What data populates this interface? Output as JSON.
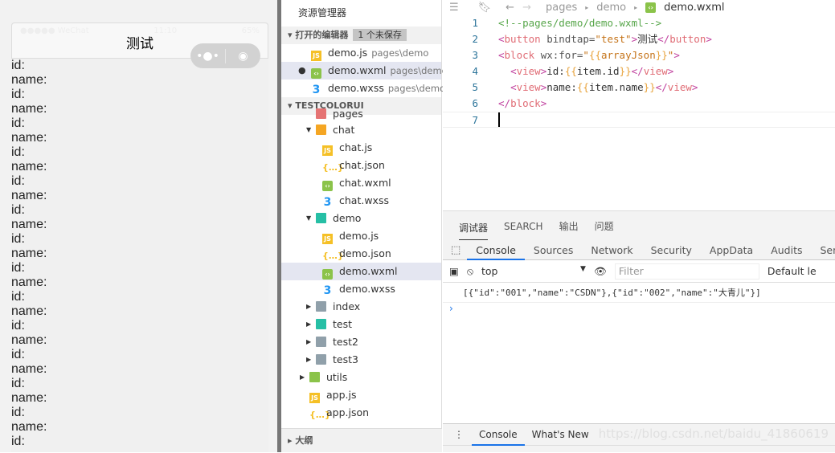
{
  "simulator": {
    "status_left": "●●●●● WeChat",
    "time": "11:10",
    "battery": "65%",
    "nav_title": "测试",
    "capsule_more": "•●•",
    "capsule_close": "◉",
    "content_lines": [
      "id:",
      "name:",
      "id:",
      "name:",
      "id:",
      "name:",
      "id:",
      "name:",
      "id:",
      "name:",
      "id:",
      "name:",
      "id:",
      "name:",
      "id:",
      "name:",
      "id:",
      "name:",
      "id:",
      "name:",
      "id:",
      "name:",
      "id:",
      "name:",
      "id:",
      "name:",
      "id:"
    ]
  },
  "explorer": {
    "title": "资源管理器",
    "open_editors": "打开的编辑器",
    "unsaved": "1 个未保存",
    "open_files": [
      {
        "name": "demo.js",
        "path": "pages\\demo",
        "type": "js"
      },
      {
        "name": "demo.wxml",
        "path": "pages\\demo",
        "type": "wx",
        "modified": true,
        "selected": true
      },
      {
        "name": "demo.wxss",
        "path": "pages\\demo",
        "type": "css"
      }
    ],
    "project": "TESTCOLORUI",
    "tree": [
      {
        "name": "pages",
        "type": "folder-red",
        "indent": 1,
        "partial": true
      },
      {
        "name": "chat",
        "type": "folder-orange",
        "indent": 1,
        "arrow": "▼"
      },
      {
        "name": "chat.js",
        "type": "js",
        "indent": 2
      },
      {
        "name": "chat.json",
        "type": "json",
        "indent": 2
      },
      {
        "name": "chat.wxml",
        "type": "wx",
        "indent": 2
      },
      {
        "name": "chat.wxss",
        "type": "css",
        "indent": 2
      },
      {
        "name": "demo",
        "type": "folder-teal",
        "indent": 1,
        "arrow": "▼"
      },
      {
        "name": "demo.js",
        "type": "js",
        "indent": 2
      },
      {
        "name": "demo.json",
        "type": "json",
        "indent": 2
      },
      {
        "name": "demo.wxml",
        "type": "wx",
        "indent": 2,
        "selected": true
      },
      {
        "name": "demo.wxss",
        "type": "css",
        "indent": 2
      },
      {
        "name": "index",
        "type": "folder",
        "indent": 1,
        "arrow": "▶"
      },
      {
        "name": "test",
        "type": "folder-teal",
        "indent": 1,
        "arrow": "▶"
      },
      {
        "name": "test2",
        "type": "folder",
        "indent": 1,
        "arrow": "▶"
      },
      {
        "name": "test3",
        "type": "folder",
        "indent": 1,
        "arrow": "▶"
      },
      {
        "name": "utils",
        "type": "folder-green",
        "indent": 0,
        "arrow": "▶"
      },
      {
        "name": "app.js",
        "type": "js",
        "indent": 0
      },
      {
        "name": "app.json",
        "type": "json",
        "indent": 0
      }
    ],
    "outline": "大纲"
  },
  "editor": {
    "breadcrumb": [
      "pages",
      "demo",
      "demo.wxml"
    ],
    "lines": [
      [
        [
          "c-cm",
          "<!--pages/demo/demo.wxml-->"
        ]
      ],
      [
        [
          "c-tag",
          "<"
        ],
        [
          "c-tn",
          "button"
        ],
        [
          "c-at",
          " bindtap="
        ],
        [
          "c-st",
          "\"test\""
        ],
        [
          "c-tag",
          ">"
        ],
        [
          "c-tx",
          "测试"
        ],
        [
          "c-tag",
          "</"
        ],
        [
          "c-tn",
          "button"
        ],
        [
          "c-tag",
          ">"
        ]
      ],
      [
        [
          "c-tag",
          "<"
        ],
        [
          "c-tn",
          "block"
        ],
        [
          "c-at",
          " wx:for="
        ],
        [
          "c-st",
          "\""
        ],
        [
          "c-br",
          "{{"
        ],
        [
          "c-st",
          "arrayJson"
        ],
        [
          "c-br",
          "}}"
        ],
        [
          "c-st",
          "\""
        ],
        [
          "c-tag",
          ">"
        ]
      ],
      [
        [
          "c-tx",
          "  "
        ],
        [
          "c-tag",
          "<"
        ],
        [
          "c-tn",
          "view"
        ],
        [
          "c-tag",
          ">"
        ],
        [
          "c-tx",
          "id:"
        ],
        [
          "c-br",
          "{{"
        ],
        [
          "c-tx",
          "item.id"
        ],
        [
          "c-br",
          "}}"
        ],
        [
          "c-tag",
          "</"
        ],
        [
          "c-tn",
          "view"
        ],
        [
          "c-tag",
          ">"
        ]
      ],
      [
        [
          "c-tx",
          "  "
        ],
        [
          "c-tag",
          "<"
        ],
        [
          "c-tn",
          "view"
        ],
        [
          "c-tag",
          ">"
        ],
        [
          "c-tx",
          "name:"
        ],
        [
          "c-br",
          "{{"
        ],
        [
          "c-tx",
          "item.name"
        ],
        [
          "c-br",
          "}}"
        ],
        [
          "c-tag",
          "</"
        ],
        [
          "c-tn",
          "view"
        ],
        [
          "c-tag",
          ">"
        ]
      ],
      [
        [
          "c-tag",
          "</"
        ],
        [
          "c-tn",
          "block"
        ],
        [
          "c-tag",
          ">"
        ]
      ],
      []
    ]
  },
  "devtools": {
    "panel_tabs": [
      "调试器",
      "SEARCH",
      "输出",
      "问题"
    ],
    "tool_tabs": [
      "Console",
      "Sources",
      "Network",
      "Security",
      "AppData",
      "Audits",
      "Sensor"
    ],
    "context": "top",
    "filter_placeholder": "Filter",
    "levels": "Default le",
    "log": "[{\"id\":\"001\",\"name\":\"CSDN\"},{\"id\":\"002\",\"name\":\"大青儿\"}]",
    "prompt": "›",
    "drawer_tabs": [
      "Console",
      "What's New"
    ],
    "watermark": "https://blog.csdn.net/baidu_41860619"
  }
}
